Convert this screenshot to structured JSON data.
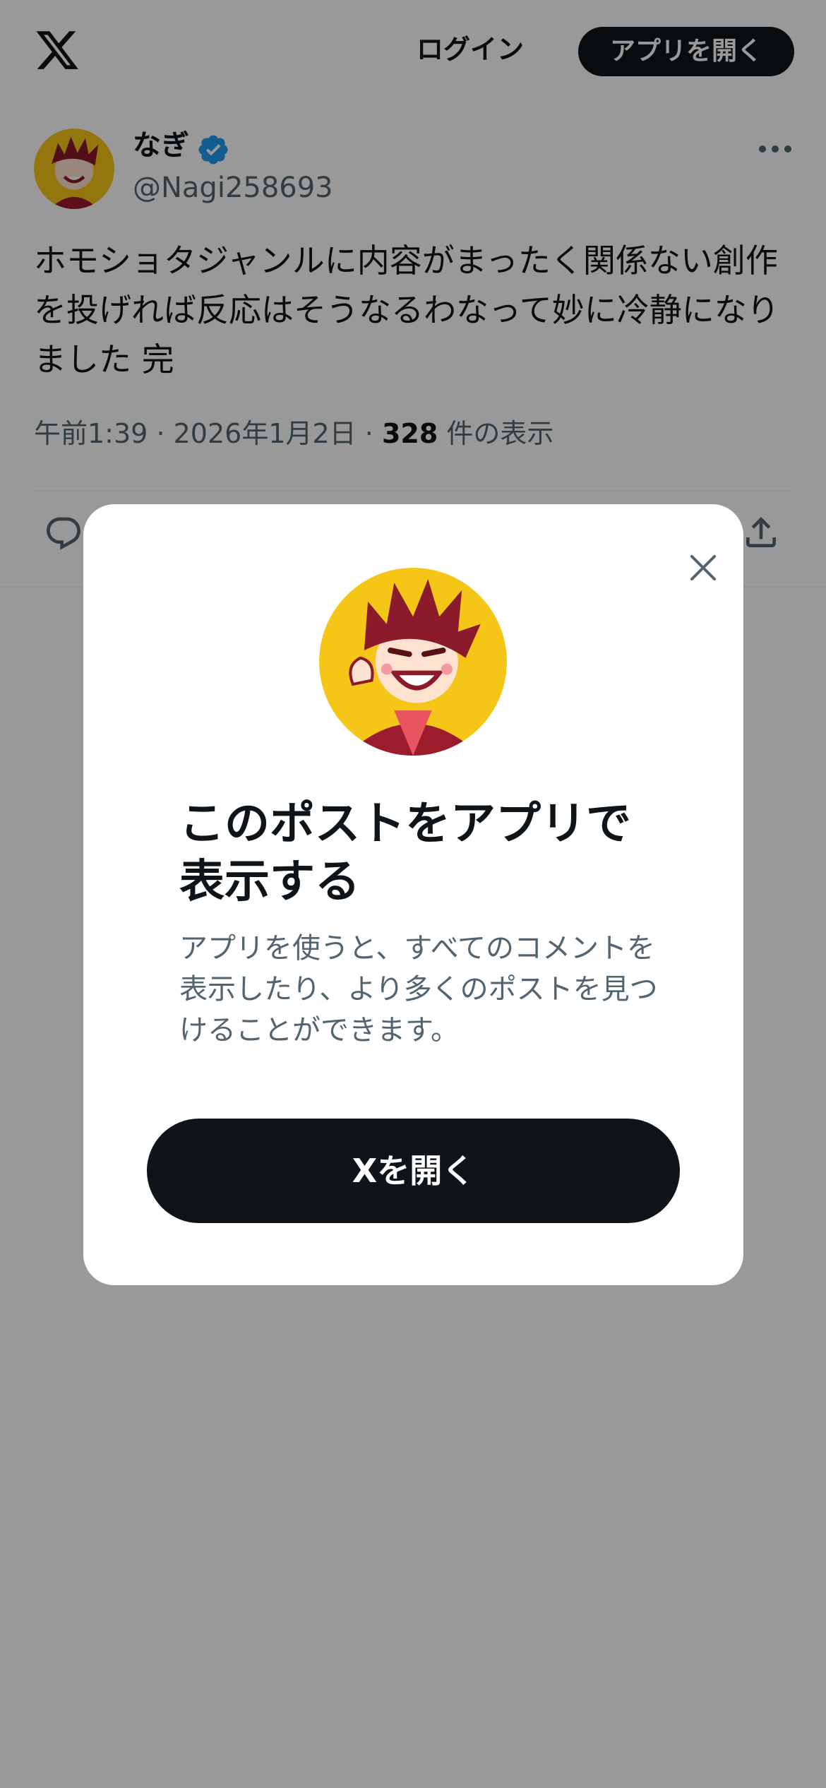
{
  "topbar": {
    "logo_icon": "x-logo-icon",
    "login_label": "ログイン",
    "open_app_label": "アプリを開く"
  },
  "post": {
    "author": {
      "display_name": "なぎ",
      "handle": "@Nagi258693",
      "verified": true,
      "avatar_icon": "anime-boy-avatar"
    },
    "text": "ホモショタジャンルに内容がまったく関係ない創作を投げれば反応はそうなるわなって妙に冷静になりました 完",
    "time": "午前1:39",
    "separator": "·",
    "date": "2026年1月2日",
    "views_count": "328",
    "views_label": "件の表示",
    "more_icon": "more-horizontal-icon",
    "actions": [
      "reply-icon",
      "share-icon"
    ]
  },
  "modal": {
    "title": "このポストをアプリで表示する",
    "description": "アプリを使うと、すべてのコメントを表示したり、より多くのポストを見つけることができます。",
    "cta_label": "Xを開く",
    "close_icon": "close-icon"
  },
  "colors": {
    "text_primary": "#0f1419",
    "text_secondary": "#536471",
    "verified_blue": "#1d9bf0",
    "button_dark": "#0f1419",
    "avatar_yellow": "#f5c518",
    "overlay": "rgba(0,0,0,0.4)"
  }
}
